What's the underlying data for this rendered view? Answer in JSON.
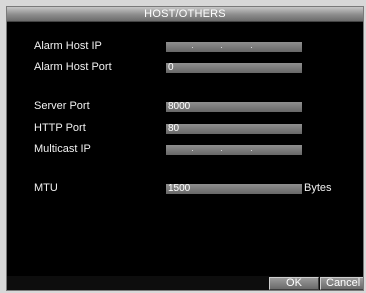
{
  "dialog": {
    "title": "HOST/OTHERS"
  },
  "fields": {
    "alarm_host_ip": {
      "label": "Alarm Host IP",
      "value": ""
    },
    "alarm_host_port": {
      "label": "Alarm Host Port",
      "value": "0"
    },
    "server_port": {
      "label": "Server Port",
      "value": "8000"
    },
    "http_port": {
      "label": "HTTP Port",
      "value": "80"
    },
    "multicast_ip": {
      "label": "Multicast IP",
      "value": ""
    },
    "mtu": {
      "label": "MTU",
      "value": "1500",
      "unit": "Bytes"
    }
  },
  "buttons": {
    "ok": "OK",
    "cancel": "Cancel"
  }
}
